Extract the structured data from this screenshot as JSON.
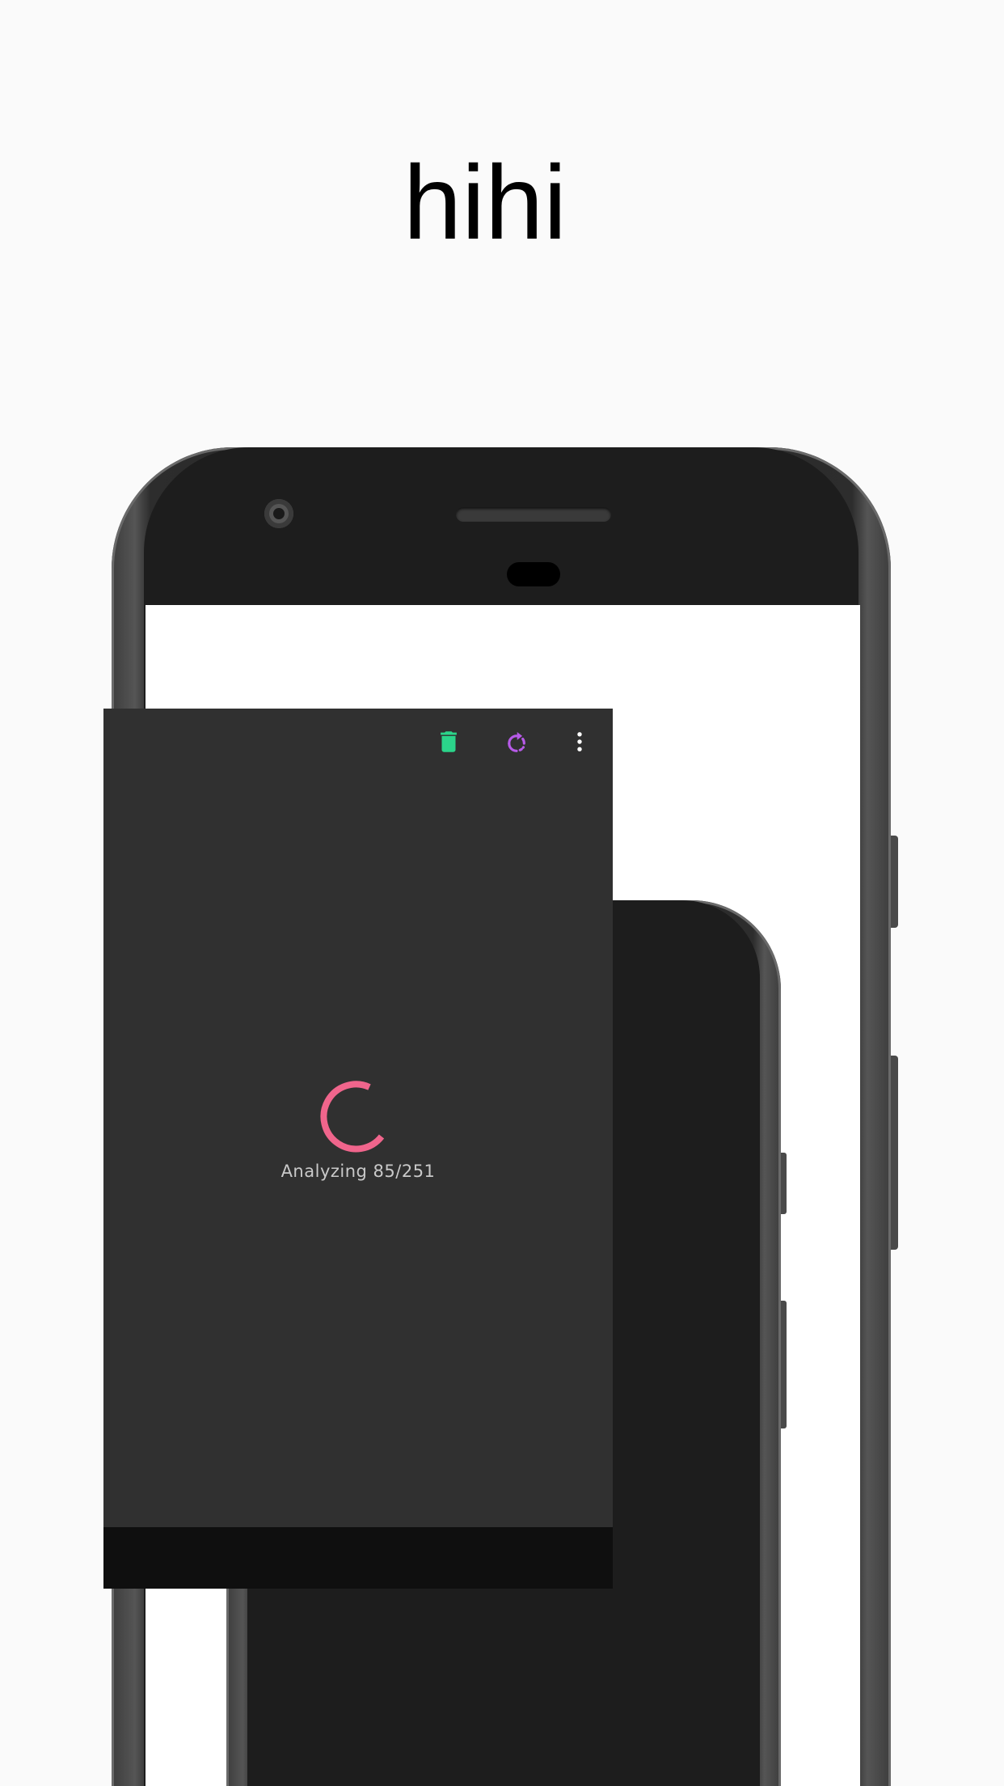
{
  "headline": "hihi",
  "app": {
    "toolbar": {
      "delete_icon": "trash-icon",
      "refresh_icon": "refresh-icon",
      "more_icon": "more-vert-icon"
    },
    "status": {
      "text": "Analyzing 85/251"
    },
    "colors": {
      "delete_icon": "#2bd48a",
      "refresh_icon": "#b75ae8",
      "spinner": "#f0658c",
      "background": "#303030",
      "nav_bar": "#0f0f0f"
    }
  }
}
